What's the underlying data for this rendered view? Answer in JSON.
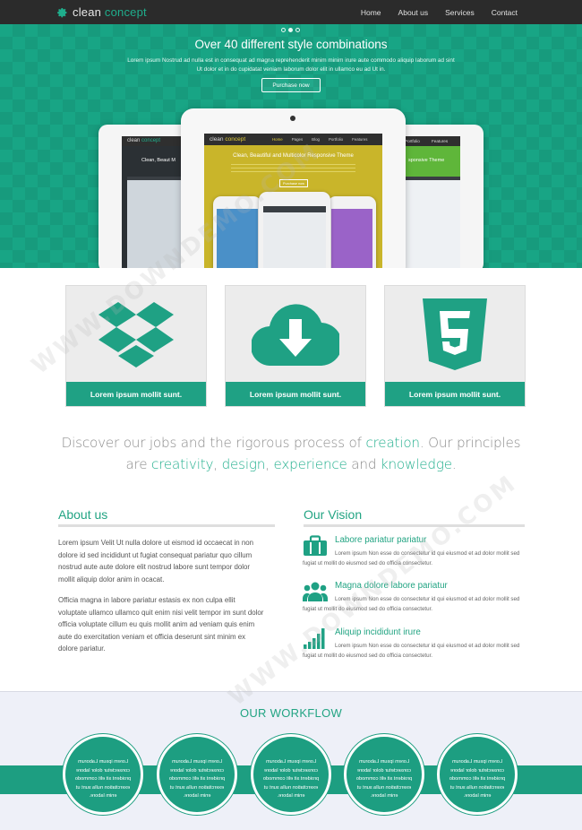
{
  "header": {
    "brand_part1": "clean",
    "brand_part2": "concept",
    "nav": [
      "Home",
      "About us",
      "Services",
      "Contact"
    ]
  },
  "hero": {
    "title": "Over 40 different style combinations",
    "text": "Lorem ipsum Nostrud ad nulla est in consequat ad magna reprehenderit minim minim irure aute commodo aliquip laborum ad sint Ut dolor et in do cupidatat veniam laborum dolor elit in ullamco eu ad Ut in.",
    "button": "Purchase now",
    "slide_count": 3,
    "active_slide": 2,
    "mockup": {
      "brand_part1": "clean",
      "brand_part2": "concept",
      "nav": [
        "Home",
        "Pages",
        "Blog",
        "Portfolio",
        "Features"
      ],
      "left_nav": "Pages",
      "right_nav": [
        "Portfolio",
        "Features"
      ],
      "headline": "Clean, Beautiful and Multicolor Responsive Theme",
      "left_caption": "Clean, Beaut M",
      "right_caption": "sponsive Theme",
      "button": "Purchase now"
    }
  },
  "features": [
    {
      "icon": "dropbox-icon",
      "label": "Lorem ipsum mollit sunt."
    },
    {
      "icon": "cloud-download-icon",
      "label": "Lorem ipsum mollit sunt."
    },
    {
      "icon": "html5-icon",
      "label": "Lorem ipsum mollit sunt."
    }
  ],
  "tagline": {
    "p1": "Discover our jobs and the rigorous process of ",
    "h1": "creation",
    "p2": ". Our principles are ",
    "h2": "creativity",
    "p3": ", ",
    "h3": "design",
    "p4": ", ",
    "h4": "experience",
    "p5": " and ",
    "h5": "knowledge",
    "p6": "."
  },
  "about": {
    "title": "About us",
    "p1": "Lorem ipsum Velit Ut nulla dolore ut eismod id occaecat in non dolore id sed incididunt ut fugiat consequat pariatur quo cillum nostrud aute aute dolore elit nostrud labore sunt tempor dolor mollit aliquip dolor anim in ocacat.",
    "p2": "Officia magna in labore pariatur estasis ex non culpa ellit voluptate ullamco ullamco quit enim nisi velit tempor im sunt dolor officia voluptate cillum eu quis mollit anim ad veniam quis enim aute do exercitation veniam et officia deserunt sint minim ex dolore pariatur."
  },
  "vision": {
    "title": "Our Vision",
    "items": [
      {
        "icon": "briefcase-icon",
        "title": "Labore pariatur pariatur",
        "text": "Lorem ipsum Non esse do consectetur id qui eiusmod et ad dolor mollit sed fugiat ut mollit do eiusmod sed do officia consectetur."
      },
      {
        "icon": "team-icon",
        "title": "Magna dolore labore pariatur",
        "text": "Lorem ipsum Non esse do consectetur id qui eiusmod et ad dolor mollit sed fugiat ut mollit do eiusmod sed do officia consectetur."
      },
      {
        "icon": "bar-chart-icon",
        "title": "Aliquip incididunt irure",
        "text": "Lorem ipsum Non esse do consectetur id qui eiusmod et ad dolor mollit sed fugiat ut mollit do eiusmod sed do officia consectetur."
      }
    ]
  },
  "workflow": {
    "title": "OUR WORKFLOW",
    "items": [
      "Lorem ipsum Laborum consectetur dolor labore proident sit elit commodo exercitation nulla sunt ut enim labore.",
      "Lorem ipsum Laborum consectetur dolor labore proident sit elit commodo exercitation nulla sunt ut enim labore.",
      "Lorem ipsum Laborum consectetur dolor labore proident sit elit commodo exercitation nulla sunt ut enim labore.",
      "Lorem ipsum Laborum consectetur dolor labore proident sit elit commodo exercitation nulla sunt ut enim labore.",
      "Lorem ipsum Laborum consectetur dolor labore proident sit elit commodo exercitation nulla sunt ut enim labore."
    ]
  },
  "watermark": "WWW.DOWNDEMO.COM",
  "colors": {
    "accent": "#1fa184",
    "topbar": "#2b2b2b",
    "hero": "#18a585",
    "workflow_bg": "#eef0f8"
  }
}
